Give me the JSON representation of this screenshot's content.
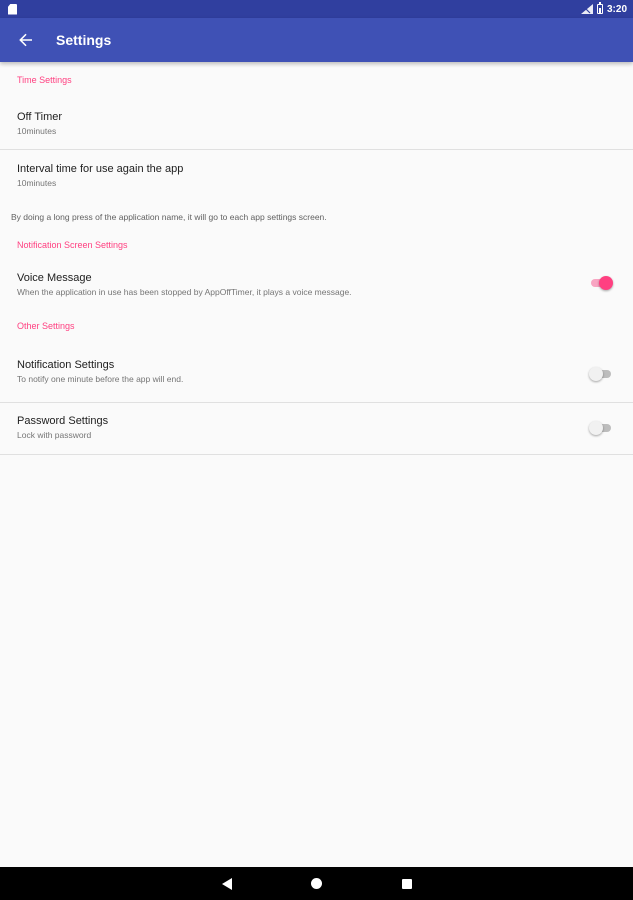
{
  "status_bar": {
    "time": "3:20"
  },
  "app_bar": {
    "title": "Settings"
  },
  "sections": {
    "time": {
      "header": "Time Settings",
      "off_timer": {
        "title": "Off Timer",
        "summary": "10minutes"
      },
      "interval": {
        "title": "Interval time for use again the app",
        "summary": "10minutes"
      }
    },
    "note": "By doing a long press of the application name, it will go to each app settings screen.",
    "notification_screen": {
      "header": "Notification Screen Settings",
      "voice_message": {
        "title": "Voice Message",
        "summary": "When the application in use has been stopped by AppOffTimer, it plays a voice message.",
        "enabled": true
      }
    },
    "other": {
      "header": "Other Settings",
      "notification": {
        "title": "Notification Settings",
        "summary": "To notify one minute before the app will end.",
        "enabled": false
      },
      "password": {
        "title": "Password Settings",
        "summary": "Lock with password",
        "enabled": false
      }
    }
  },
  "colors": {
    "status_bar": "#303f9f",
    "app_bar": "#3f51b5",
    "accent": "#ff4081",
    "background": "#fafafa"
  },
  "icons": {
    "back": "arrow-left-icon",
    "sim": "sim-card-icon",
    "signal": "cell-signal-icon",
    "battery": "battery-icon",
    "nav_back": "nav-back-icon",
    "nav_home": "nav-home-icon",
    "nav_recent": "nav-recents-icon"
  }
}
